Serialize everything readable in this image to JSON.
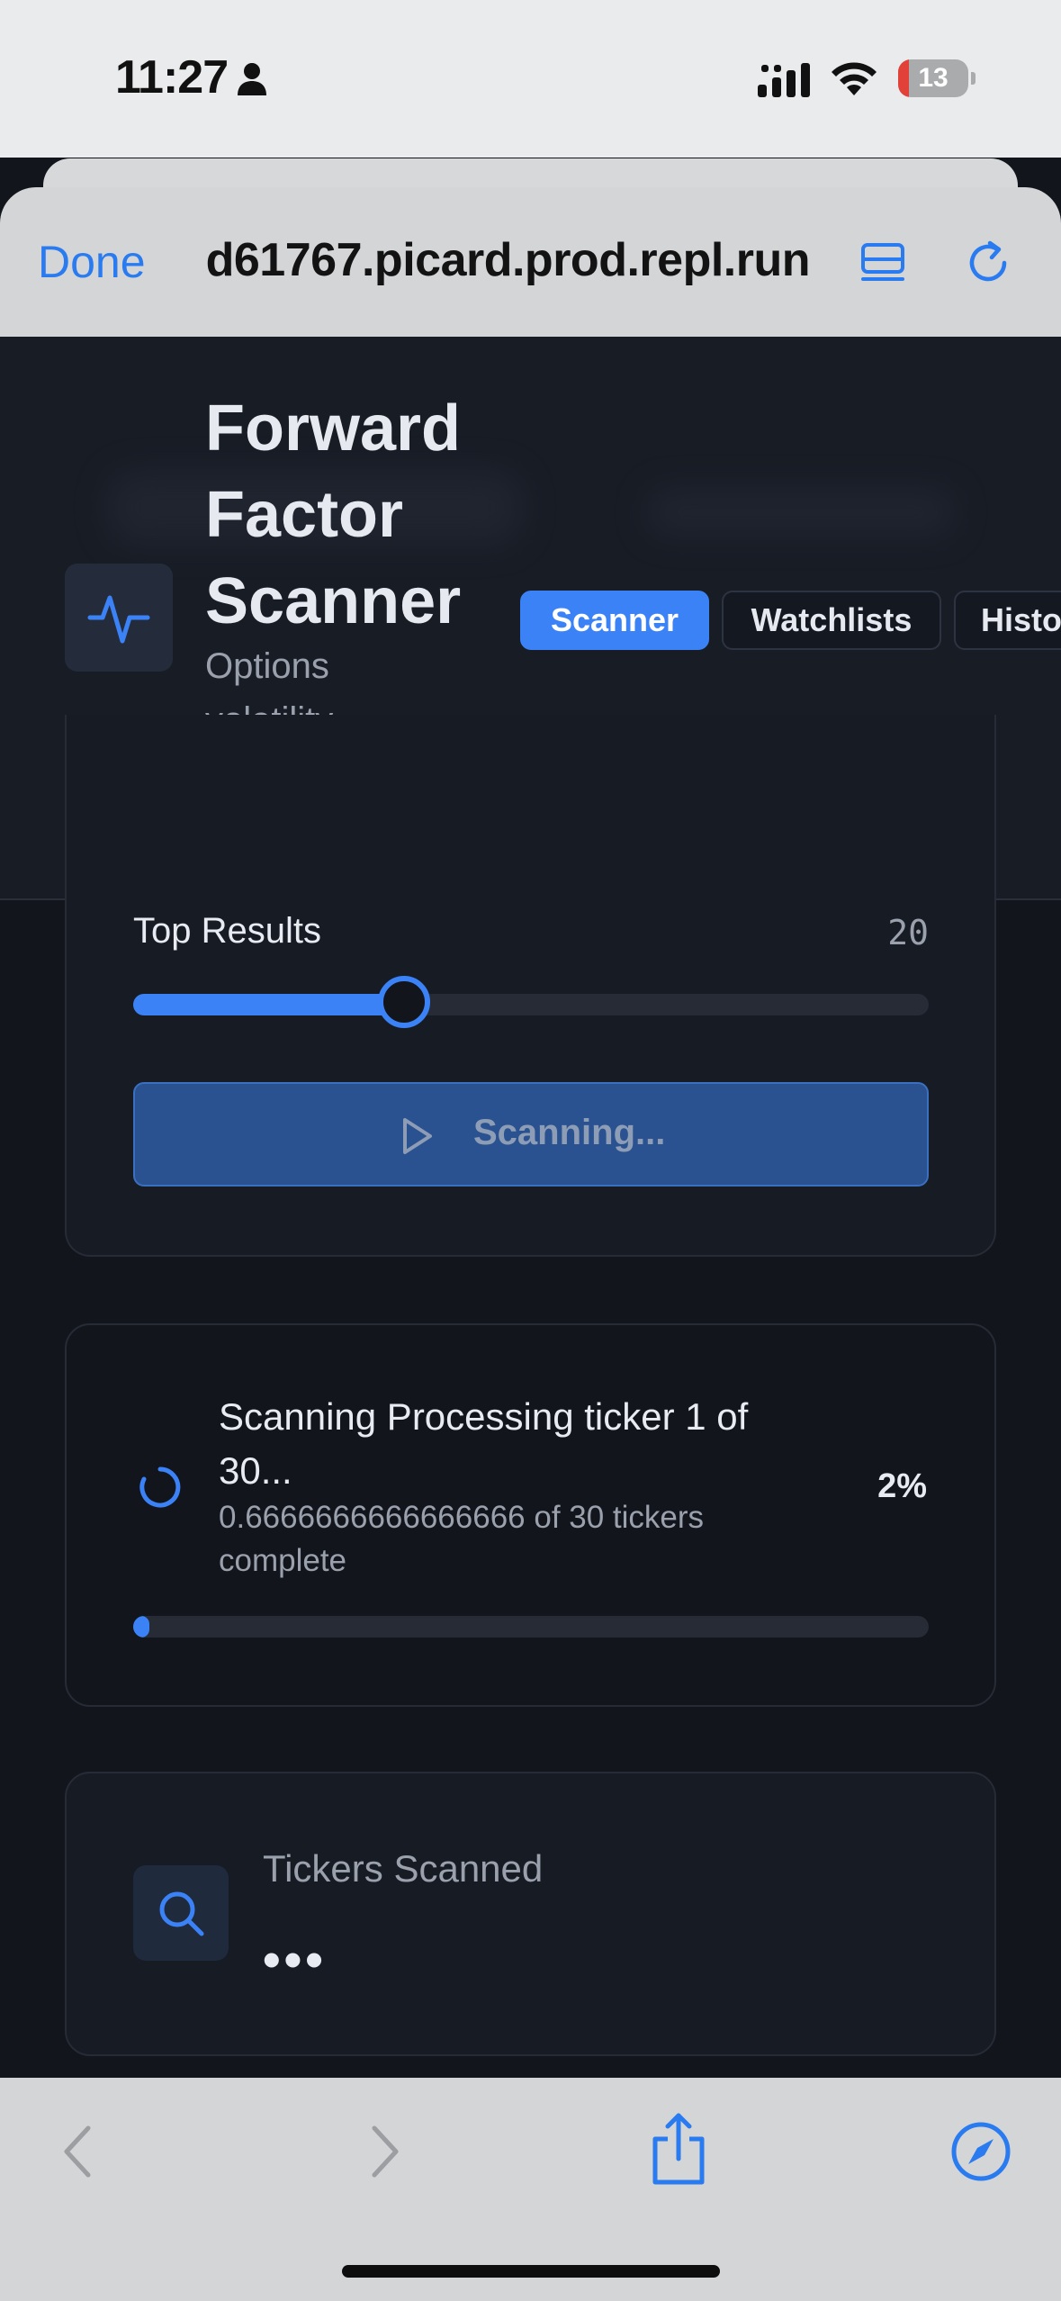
{
  "status_bar": {
    "time": "11:27",
    "battery_level": "13"
  },
  "browser": {
    "done_label": "Done",
    "url": "d61767.picard.prod.repl.run"
  },
  "app": {
    "title": "Forward Factor Scanner",
    "subtitle": "Options volatility mispricing detector",
    "tabs": [
      {
        "label": "Scanner",
        "active": true
      },
      {
        "label": "Watchlists",
        "active": false
      },
      {
        "label": "Histo",
        "active": false
      }
    ]
  },
  "settings": {
    "top_results_label": "Top Results",
    "top_results_value": "20",
    "slider_fraction": 0.34,
    "scan_button_label": "Scanning..."
  },
  "progress": {
    "title": "Scanning Processing ticker 1 of 30...",
    "subtitle": "0.6666666666666666 of 30 tickers complete",
    "percent_label": "2%",
    "fraction": 0.02
  },
  "stats": {
    "tickers_scanned_label": "Tickers Scanned",
    "tickers_scanned_value": "•••"
  },
  "colors": {
    "accent": "#3b82f6",
    "ios_blue": "#2a7bf0",
    "background": "#12151c",
    "card": "#171b24"
  }
}
